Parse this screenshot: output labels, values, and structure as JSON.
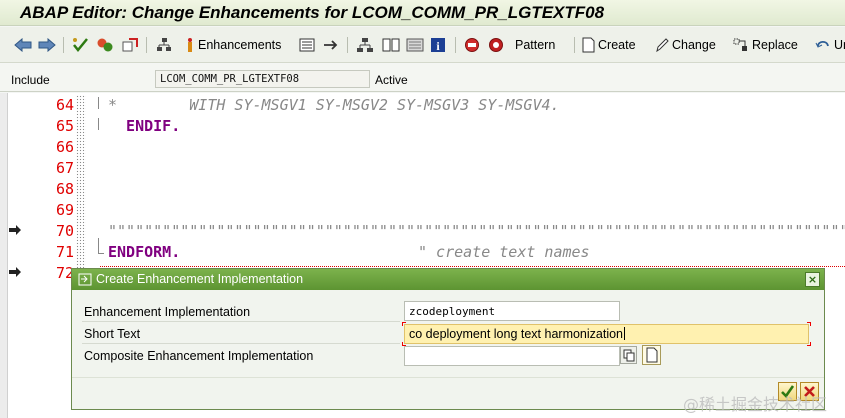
{
  "window": {
    "title": "ABAP Editor: Change Enhancements for LCOM_COMM_PR_LGTEXTF08"
  },
  "toolbar": {
    "enhancements_label": "Enhancements",
    "pattern_label": "Pattern",
    "create_label": "Create",
    "change_label": "Change",
    "replace_label": "Replace",
    "cut_label": "Un"
  },
  "include_bar": {
    "label": "Include",
    "value": "LCOM_COMM_PR_LGTEXTF08",
    "status": "Active"
  },
  "editor": {
    "lines": [
      {
        "num": "64",
        "text": "*        WITH SY-MSGV1 SY-MSGV2 SY-MSGV3 SY-MSGV4."
      },
      {
        "num": "65",
        "text": "  ENDIF."
      },
      {
        "num": "66",
        "text": ""
      },
      {
        "num": "67",
        "text": ""
      },
      {
        "num": "68",
        "text": ""
      },
      {
        "num": "69",
        "text": ""
      },
      {
        "num": "70",
        "text": "\"\"\"\"\"\"\"\"\"\"\"\"\"\"\"\"\"\"\"\"\"\"\"\"\"\"\"\"\"\"\"\"\"\"\"\"\"\"\"\"\"\"\"\"\"\"\"\"\"\"\"\"\"\"\"\"\"\"\"\"\"\"\"\"\"\"\"\"\"\"\"\"\"\"\"\"\"\"\"\"\"\"\"\""
      },
      {
        "num": "71",
        "text": "ENDFORM."
      },
      {
        "num": "72",
        "text": ""
      }
    ],
    "comment_71": "\" create text names"
  },
  "dialog": {
    "title": "Create Enhancement Implementation",
    "fields": {
      "enh_impl_label": "Enhancement Implementation",
      "enh_impl_value": "zcodeployment",
      "short_text_label": "Short Text",
      "short_text_value": "co deployment long text harmonization",
      "composite_label": "Composite Enhancement Implementation",
      "composite_value": ""
    }
  },
  "watermark": "@稀土掘金技术社区",
  "colors": {
    "title_bg": "#e6eed9",
    "dialog_title_bg": "#6aa23c",
    "line_number": "#e00000",
    "keyword": "#800080",
    "comment": "#888888",
    "active_field": "#fff1b0"
  }
}
